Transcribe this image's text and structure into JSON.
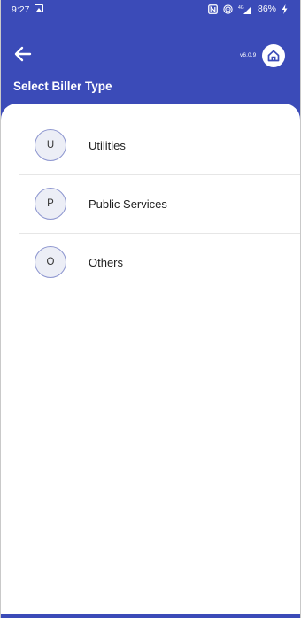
{
  "status_bar": {
    "time": "9:27",
    "battery": "86%",
    "icons": [
      "gallery-icon",
      "nfc-icon",
      "hotspot-icon",
      "signal-icon",
      "charging-icon"
    ]
  },
  "header": {
    "title": "Select Biller Type",
    "version": "v6.0.9",
    "background_color": "#3b4bb8"
  },
  "biller_types": [
    {
      "initial": "U",
      "label": "Utilities"
    },
    {
      "initial": "P",
      "label": "Public Services"
    },
    {
      "initial": "O",
      "label": "Others"
    }
  ]
}
